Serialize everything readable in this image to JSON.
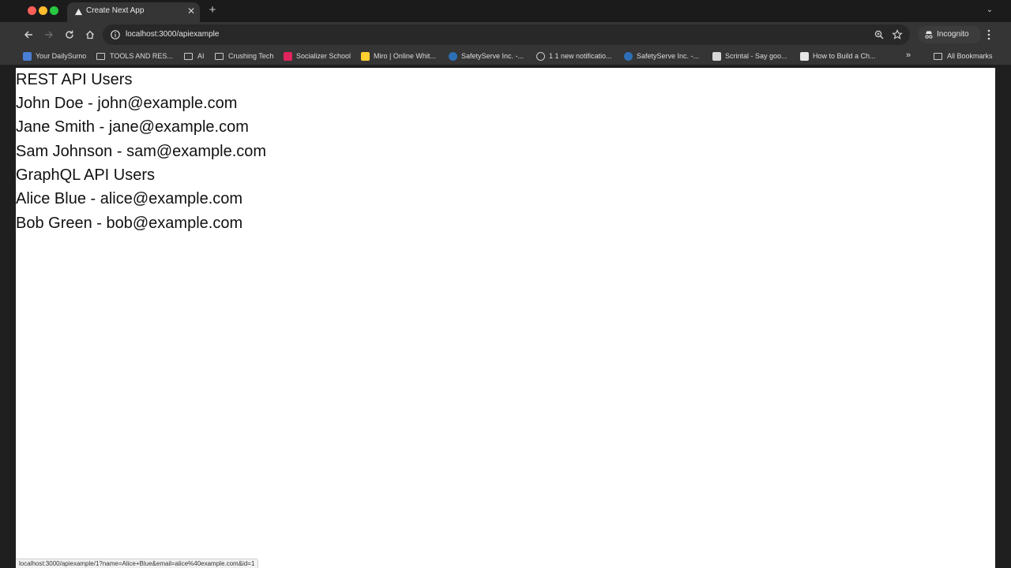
{
  "browser": {
    "tab": {
      "title": "Create Next App"
    },
    "url": "localhost:3000/apiexample",
    "profile_label": "Incognito",
    "bookmarks": [
      {
        "label": "Your DailySumo",
        "icon": "dailysumo-favicon-icon"
      },
      {
        "label": "TOOLS AND RES...",
        "icon": "folder-icon"
      },
      {
        "label": "AI",
        "icon": "folder-icon"
      },
      {
        "label": "Crushing Tech",
        "icon": "folder-icon"
      },
      {
        "label": "Socializer School",
        "icon": "socializer-favicon-icon"
      },
      {
        "label": "Miro | Online Whit...",
        "icon": "miro-favicon-icon"
      },
      {
        "label": "SafetyServe Inc. -...",
        "icon": "safetyserve-favicon-icon"
      },
      {
        "label": "1 1 new notificatio...",
        "icon": "globe-icon"
      },
      {
        "label": "SafetyServe Inc. -...",
        "icon": "safetyserve-favicon-icon"
      },
      {
        "label": "Scrintal - Say goo...",
        "icon": "scrintal-favicon-icon"
      },
      {
        "label": "How to Build a Ch...",
        "icon": "how-to-favicon-icon"
      }
    ],
    "all_bookmarks_label": "All Bookmarks",
    "status_url": "localhost:3000/apiexample/1?name=Alice+Blue&email=alice%40example.com&id=1"
  },
  "page": {
    "rest_heading": "REST API Users",
    "rest_users": [
      "John Doe - john@example.com",
      "Jane Smith - jane@example.com",
      "Sam Johnson - sam@example.com"
    ],
    "graphql_heading": "GraphQL API Users",
    "graphql_users": [
      "Alice Blue - alice@example.com",
      "Bob Green - bob@example.com"
    ]
  },
  "colors": {
    "chrome_dark": "#1f1f1f",
    "toolbar": "#353535",
    "page_background": "#ffffff",
    "page_text": "#111111"
  }
}
